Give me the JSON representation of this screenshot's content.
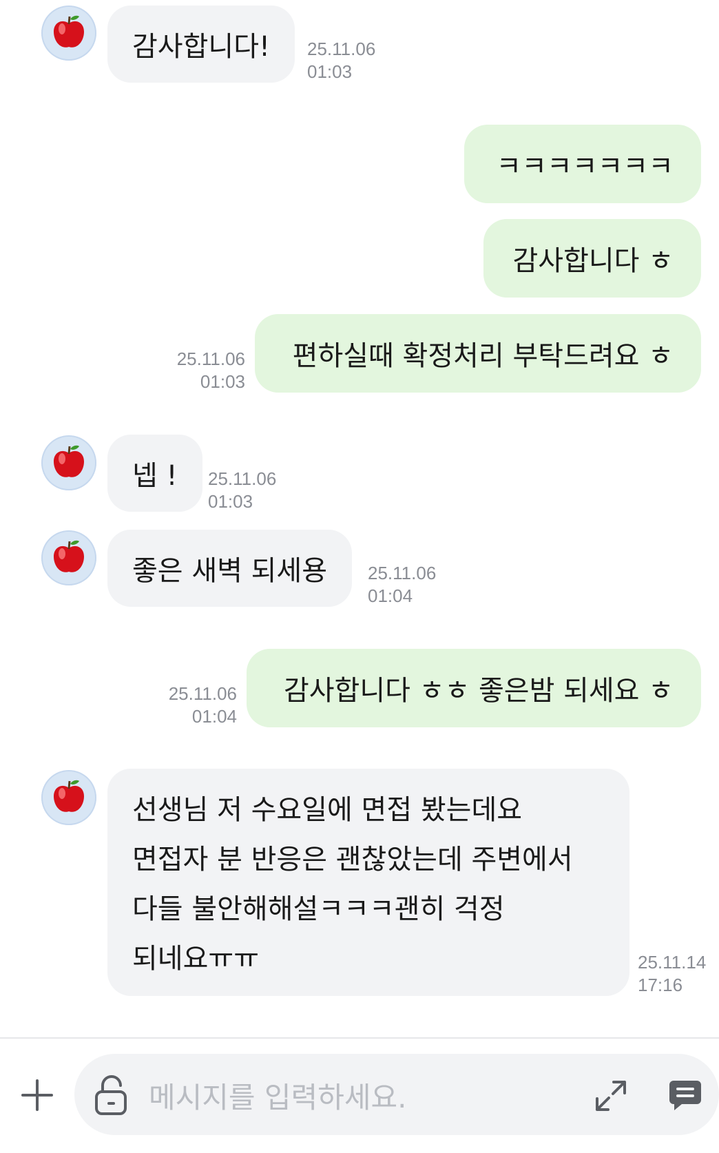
{
  "messages": [
    {
      "text": "감사합니다!",
      "date": "25.11.06",
      "time": "01:03"
    },
    {
      "text": "ㅋㅋㅋㅋㅋㅋㅋ"
    },
    {
      "text": "감사합니다 ㅎ"
    },
    {
      "text": "편하실때 확정처리 부탁드려요 ㅎ",
      "date": "25.11.06",
      "time": "01:03"
    },
    {
      "text": "넵 !",
      "date": "25.11.06",
      "time": "01:03"
    },
    {
      "text": "좋은 새벽 되세용",
      "date": "25.11.06",
      "time": "01:04"
    },
    {
      "text": "감사합니다 ㅎㅎ 좋은밤 되세요 ㅎ",
      "date": "25.11.06",
      "time": "01:04"
    },
    {
      "lines": [
        "선생님 저 수요일에 면접 봤는데요",
        "면접자 분 반응은 괜찮았는데 주변에서",
        "다들 불안해해설ㅋㅋㅋ괜히 걱정",
        "되네요ㅠㅠ"
      ],
      "date": "25.11.14",
      "time": "17:16"
    }
  ],
  "input": {
    "placeholder": "메시지를 입력하세요."
  },
  "icons": {
    "avatar": "apple-icon",
    "add": "plus-icon",
    "lock": "unlock-icon",
    "expand": "expand-icon",
    "send": "message-send-icon"
  },
  "colors": {
    "sent_bubble": "#e3f6de",
    "received_bubble": "#f2f3f5",
    "avatar_bg": "#d8e6f5",
    "apple_red": "#d6111b"
  }
}
